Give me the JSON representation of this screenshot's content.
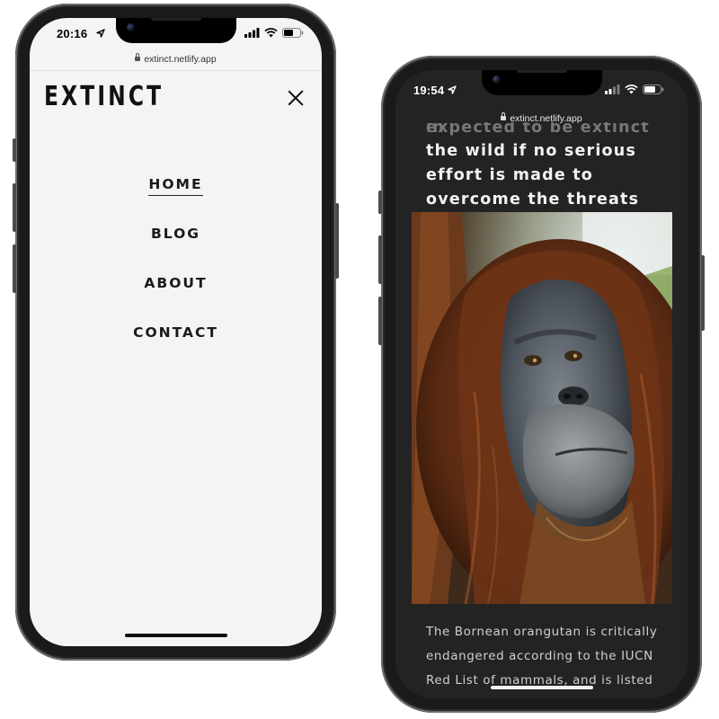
{
  "left_phone": {
    "time": "20:16",
    "url": "extinct.netlify.app",
    "brand": "EXTINCT",
    "menu": [
      {
        "label": "HOME",
        "active": true
      },
      {
        "label": "BLOG",
        "active": false
      },
      {
        "label": "ABOUT",
        "active": false
      },
      {
        "label": "CONTACT",
        "active": false
      }
    ]
  },
  "right_phone": {
    "time": "19:54",
    "url": "extinct.netlify.app",
    "heading_partial": "expected to be extinct in",
    "heading": "the wild if no serious effort is made to overcome the threats they are facing.",
    "photo_subject": "Bornean orangutan",
    "body": "The Bornean orangutan is critically endangered according to the IUCN Red List of mammals, and is listed"
  },
  "colors": {
    "left_screen_bg": "#f4f4f4",
    "right_screen_bg": "#232323",
    "frame": "#1a1a1a"
  },
  "icons": [
    "location-arrow-icon",
    "signal-icon",
    "wifi-icon",
    "battery-icon",
    "lock-icon",
    "close-icon"
  ]
}
